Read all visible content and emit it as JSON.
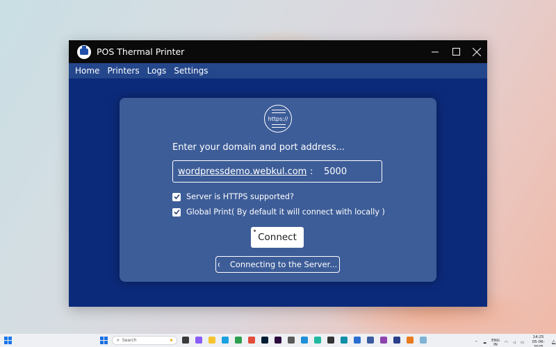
{
  "window": {
    "title": "POS Thermal Printer",
    "controls": {
      "minimize": "─",
      "maximize": "☐",
      "close": "✕"
    }
  },
  "menu": {
    "items": [
      "Home",
      "Printers",
      "Logs",
      "Settings"
    ]
  },
  "card": {
    "icon_label": "https://",
    "prompt": "Enter your domain and port address...",
    "domain_value": "wordpressdemo.webkul.com",
    "separator": ":",
    "port_value": "5000",
    "checkboxes": [
      {
        "label": "Server is HTTPS supported?",
        "checked": true
      },
      {
        "label": "Global Print( By default it will connect with locally )",
        "checked": true
      }
    ],
    "connect_label": "Connect",
    "status_text": "Connecting to the Server..."
  },
  "taskbar": {
    "search_placeholder": "Search",
    "tray_lang_top": "ENG",
    "tray_lang_bottom": "IN",
    "time": "14:25",
    "date": "05-06-2025"
  },
  "colors": {
    "window_bg": "#0c2a7a",
    "menubar_bg": "#24478c",
    "card_bg": "#3d5d98",
    "titlebar_bg": "#0a0a0a"
  }
}
